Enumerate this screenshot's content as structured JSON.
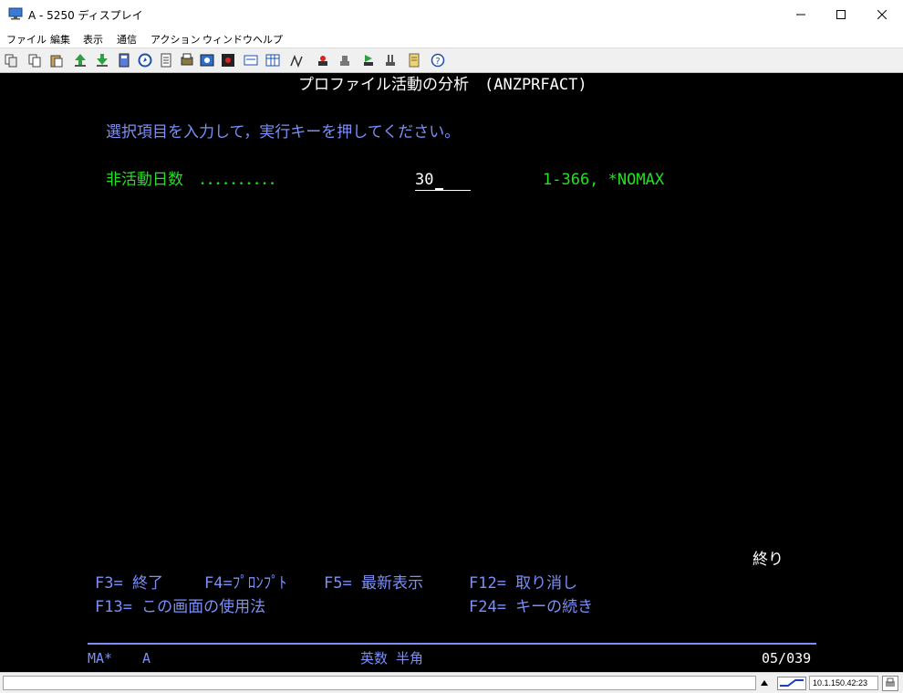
{
  "window": {
    "title": "A - 5250 ディスプレイ"
  },
  "menu": [
    "ファイル",
    "編集",
    "表示",
    "通信",
    "アクション",
    "ウィンドウ",
    "ヘルプ"
  ],
  "toolbar_icons": [
    "copy-icon",
    "copy-append-icon",
    "paste-icon",
    "send-file-icon",
    "receive-file-icon",
    "macro-icon",
    "navigate-icon",
    "notes-icon",
    "print-icon",
    "settings-icon",
    "record-icon",
    "keypad-icon",
    "calendar-icon",
    "edit-macro-icon",
    "stop-icon",
    "play-icon",
    "transfer-icon",
    "trace-icon",
    "document-icon",
    "help-icon"
  ],
  "screen": {
    "header": "プロファイル活動の分析　(ANZPRFACT)",
    "instruction": "選択項目を入力して，実行キーを押してください。",
    "field_label": "非活動日数　．．．．．．．．．．",
    "field_value": "30",
    "field_hint": "1-366, *NOMAX",
    "end_marker": "終り",
    "fkeys_row1": [
      "F3= 終了",
      "F4=ﾌﾟﾛﾝﾌﾟﾄ",
      "F5= 最新表示",
      "F12= 取り消し"
    ],
    "fkeys_row2": [
      "F13= この画面の使用法",
      "F24= キーの続き"
    ],
    "oia_left": "MA*",
    "oia_session": "A",
    "oia_mode": "英数 半角",
    "oia_cursor": "05/039"
  },
  "statusbar": {
    "address": "10.1.150.42:23"
  },
  "colors": {
    "screen_bg": "#000000",
    "header": "#ffffff",
    "prompt_blue": "#7b8ff7",
    "input_green": "#22e022"
  }
}
